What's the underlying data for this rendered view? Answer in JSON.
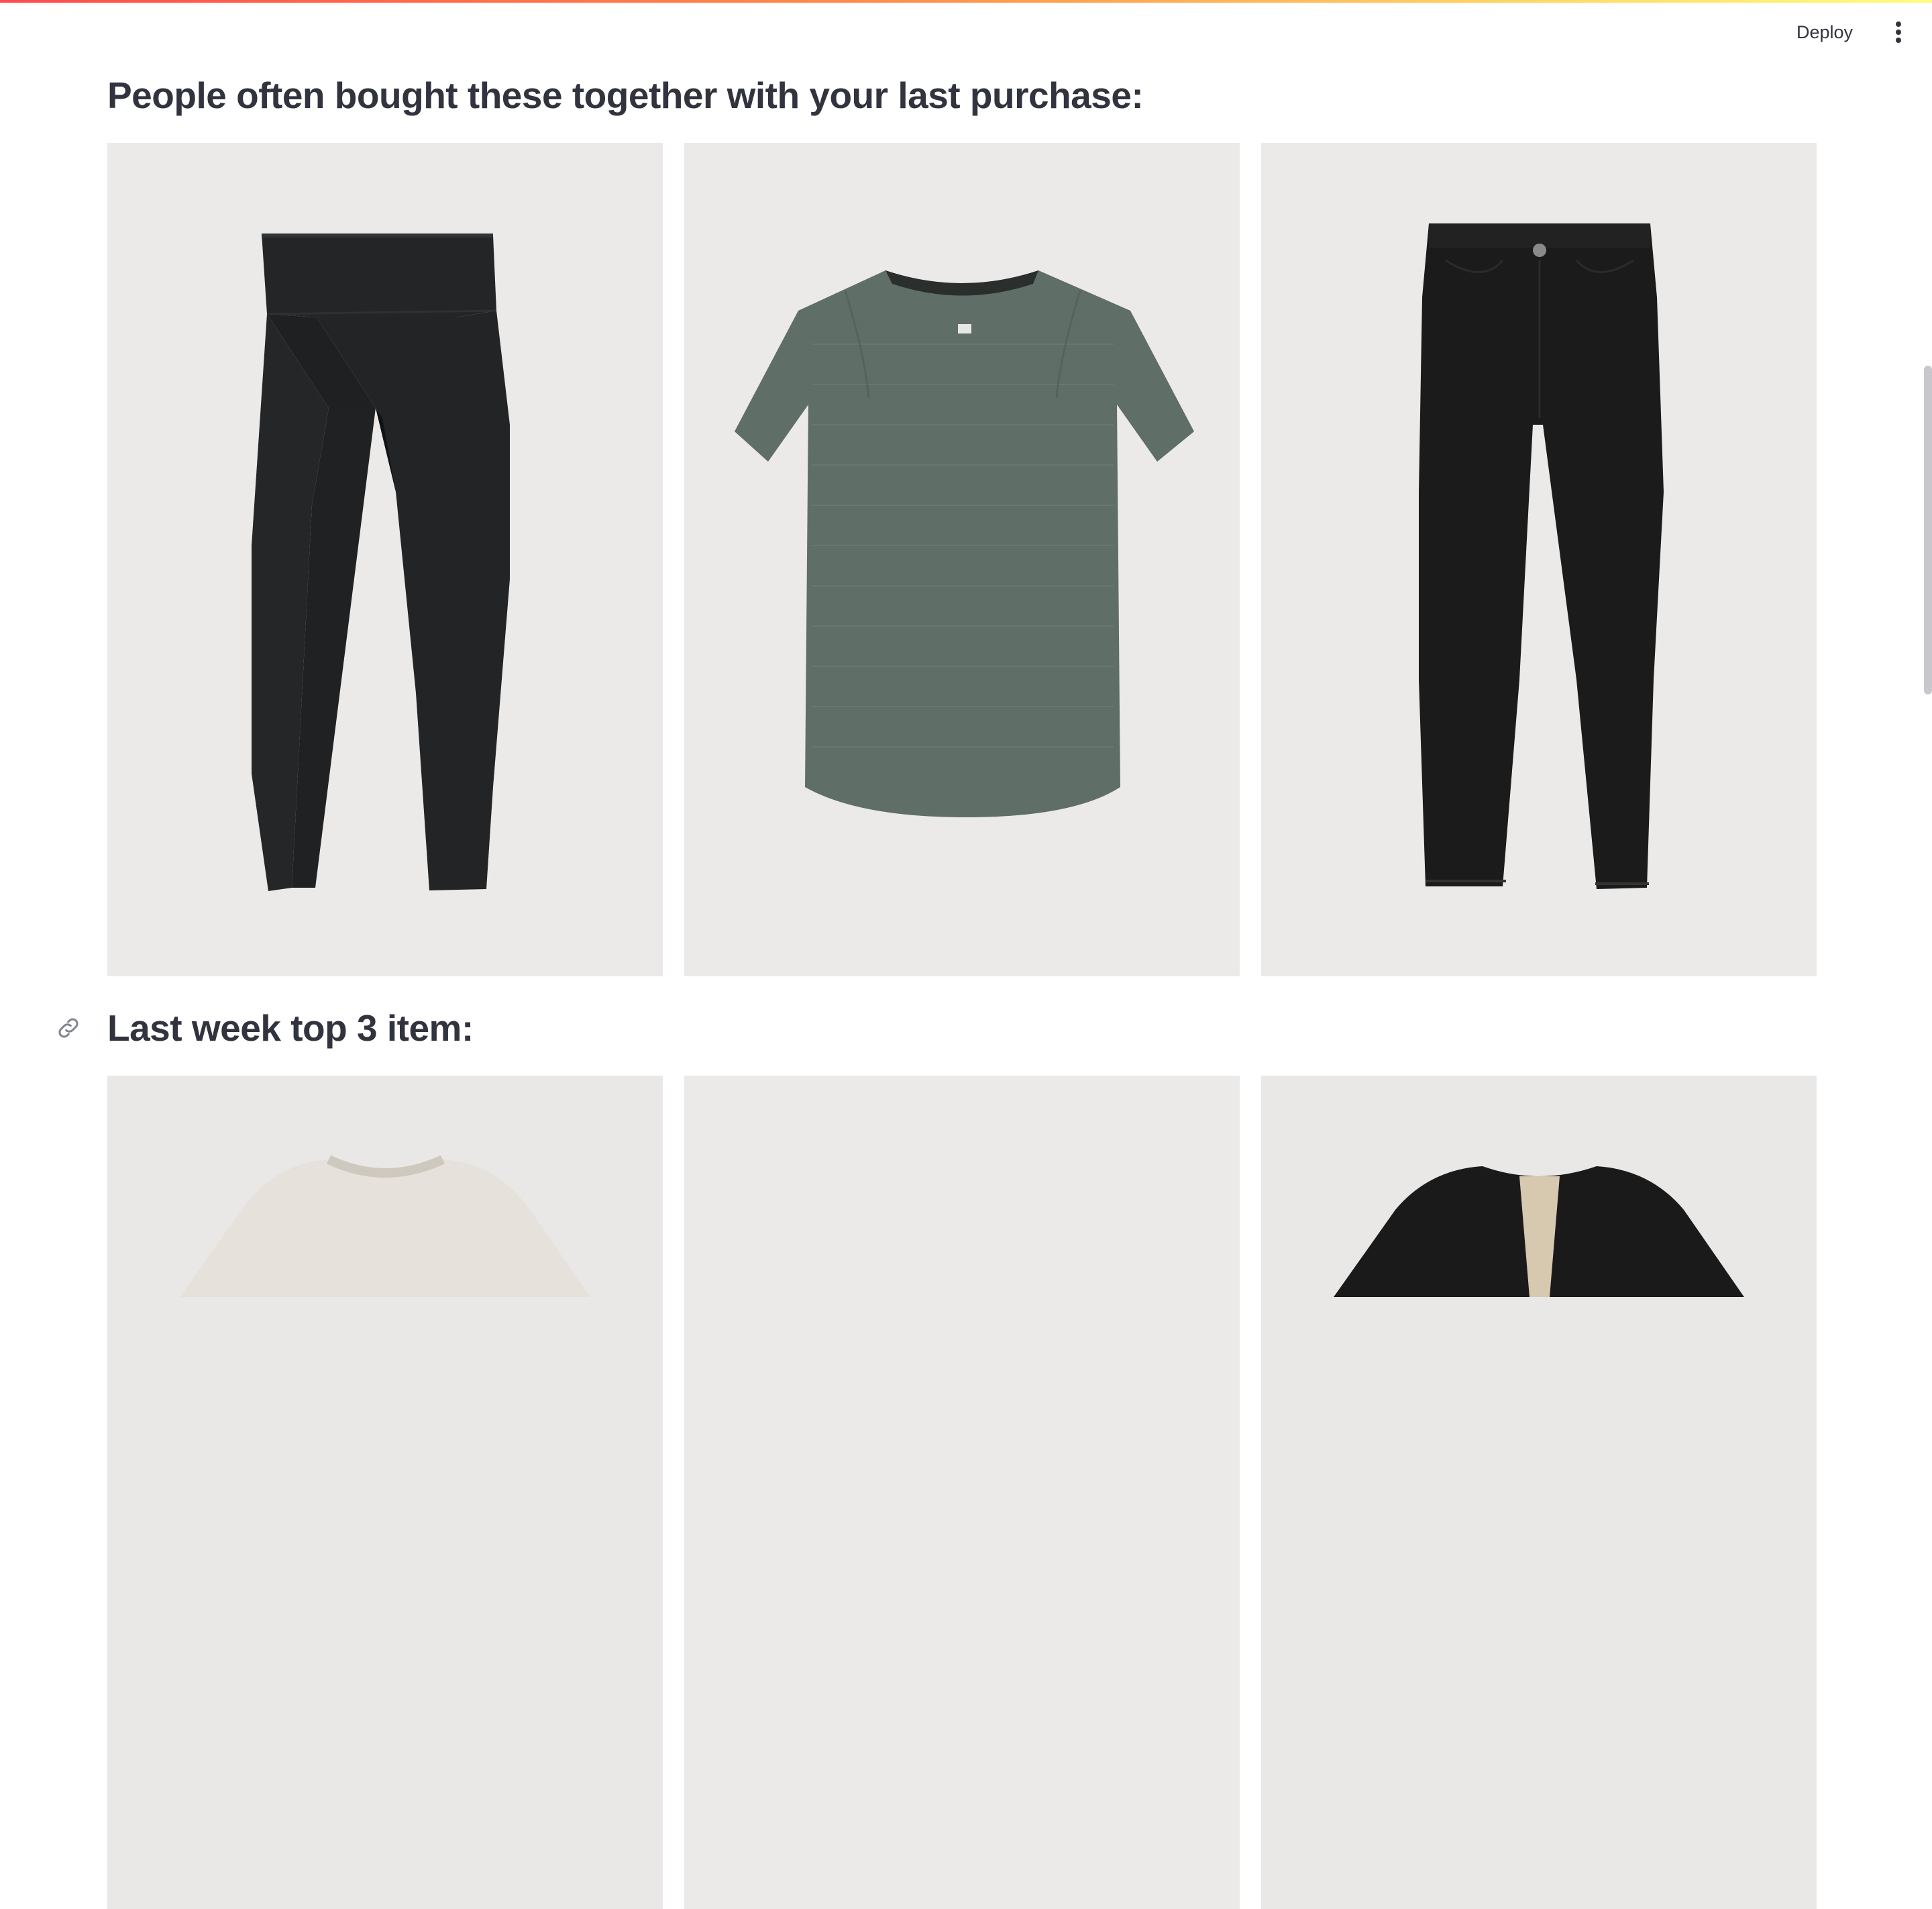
{
  "header": {
    "deploy_label": "Deploy",
    "menu_icon": "vertical-ellipsis-icon"
  },
  "sections": [
    {
      "heading": "People often bought these together with your last purchase:",
      "items": [
        {
          "icon": "black-leggings-image"
        },
        {
          "icon": "green-tshirt-image"
        },
        {
          "icon": "black-jeans-image"
        }
      ]
    },
    {
      "heading": "Last week top 3 item:",
      "anchor_icon": "link-icon",
      "items": [
        {
          "icon": "cream-sweater-image"
        },
        {
          "icon": "blank-product-image"
        },
        {
          "icon": "black-cardigan-image"
        }
      ]
    }
  ],
  "colors": {
    "text": "#31333f",
    "accent": "#ff4b4b",
    "image_background": "#ebeae8"
  }
}
